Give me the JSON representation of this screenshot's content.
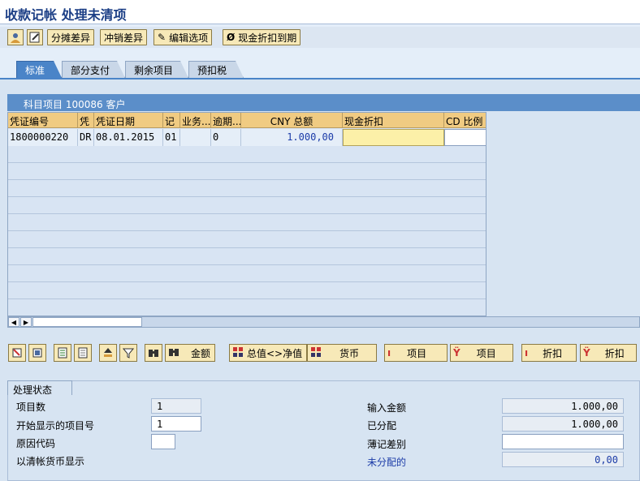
{
  "title": "收款记帐 处理未清项",
  "toolbar": {
    "icon1": "user-icon",
    "icon2": "edit-icon",
    "btn_distribute": "分摊差异",
    "btn_writeoff": "冲销差异",
    "btn_edit_options": "编辑选项",
    "btn_cash_discount": "现金折扣到期"
  },
  "tabs": [
    "标准",
    "部分支付",
    "剩余项目",
    "预扣税"
  ],
  "grid": {
    "header": "科目项目 100086 客户",
    "columns": [
      "凭证编号",
      "凭",
      "凭证日期",
      "记",
      "业务...",
      "逾期...",
      "CNY 总额",
      "现金折扣",
      "CD 比例"
    ],
    "rows": [
      [
        "1800000220",
        "DR",
        "08.01.2015",
        "01",
        "",
        "0",
        "1.000,00",
        "",
        ""
      ]
    ]
  },
  "actions": {
    "btn_amount": "金额",
    "btn_gross_net": "总值<>净值",
    "btn_currency": "货币",
    "btn_items1": "项目",
    "btn_items2": "项目",
    "btn_discount1": "折扣",
    "btn_discount2": "折扣"
  },
  "status": {
    "title": "处理状态",
    "item_count_label": "项目数",
    "item_count": "1",
    "first_item_label": "开始显示的项目号",
    "first_item": "1",
    "reason_code_label": "原因代码",
    "reason_code": "",
    "display_in_clearing_currency": "以清帐货币显示",
    "entered_amount_label": "输入金额",
    "entered_amount": "1.000,00",
    "assigned_label": "已分配",
    "assigned": "1.000,00",
    "diff_label": "薄记差别",
    "diff": "",
    "unassigned_label": "未分配的",
    "unassigned": "0,00"
  }
}
